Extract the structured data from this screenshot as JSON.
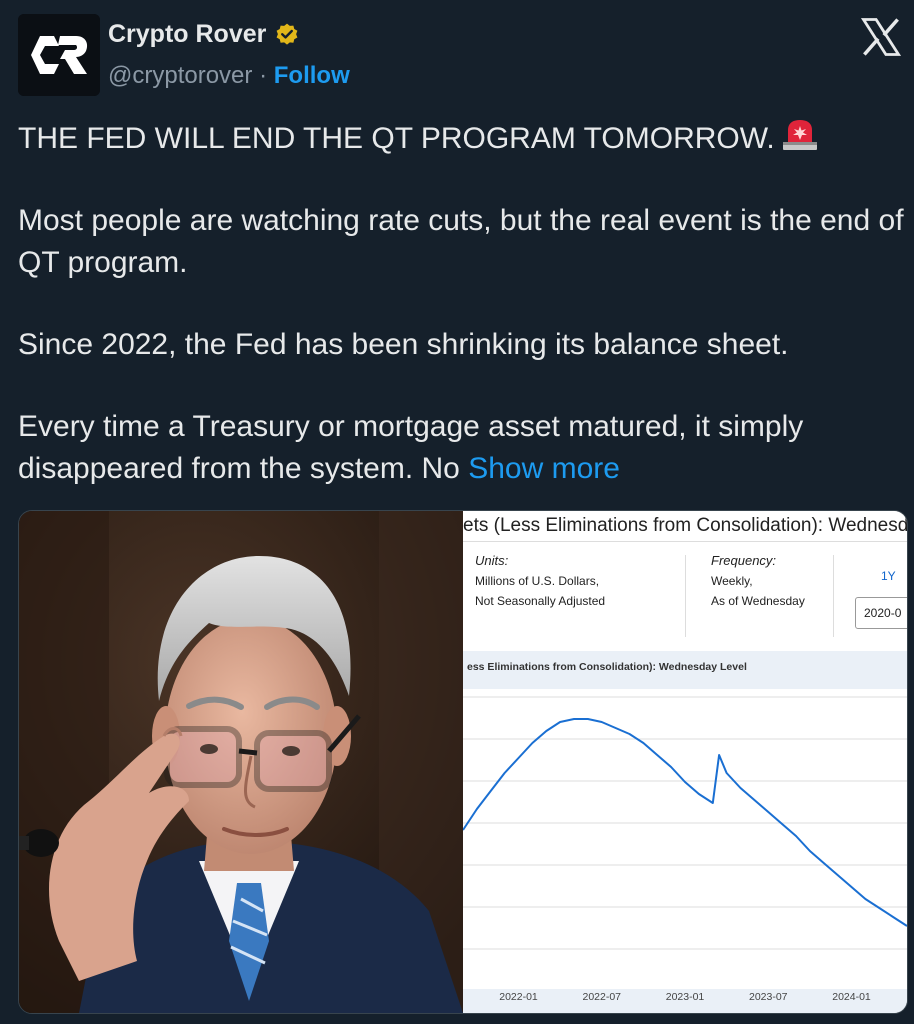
{
  "tweet": {
    "author": {
      "name": "Crypto Rover",
      "handle": "@cryptorover",
      "separator": "·",
      "follow_label": "Follow",
      "avatar_text": "CR"
    },
    "paragraphs": [
      "THE FED WILL END THE QT PROGRAM TOMORROW.",
      "Most people are watching rate cuts, but the real event is the end of QT program.",
      "Since 2022, the Fed has been shrinking its balance sheet.",
      "Every time a Treasury or mortgage asset matured, it simply disappeared from the system. No"
    ],
    "show_more_label": "Show more",
    "icons": {
      "verified": "verified-badge-icon",
      "platform": "x-logo-icon",
      "siren": "siren-emoji-icon"
    },
    "colors": {
      "background": "#15202b",
      "accent": "#1d9bf0",
      "text": "#e7e9ea",
      "muted": "#8b98a5",
      "verified": "#e2b719"
    }
  },
  "media": {
    "fred_panel": {
      "title_fragment": "ets (Less Eliminations from Consolidation): Wednesd",
      "units_label": "Units:",
      "units_line1": "Millions of U.S. Dollars,",
      "units_line2": "Not Seasonally Adjusted",
      "frequency_label": "Frequency:",
      "frequency_line1": "Weekly,",
      "frequency_line2": "As of Wednesday",
      "range_button": "1Y",
      "date_input": "2020-0",
      "chart_title": "ess Eliminations from Consolidation): Wednesday Level"
    }
  },
  "chart_data": {
    "type": "line",
    "title": "ess Eliminations from Consolidation): Wednesday Level",
    "xlabel": "",
    "ylabel": "",
    "x_tick_labels": [
      "2022-01",
      "2022-07",
      "2023-01",
      "2023-07",
      "2024-01"
    ],
    "x_range": [
      "2021-09",
      "2024-05"
    ],
    "y_range": [
      0,
      100
    ],
    "grid": true,
    "series": [
      {
        "color": "#1a6fd2",
        "points": [
          [
            "2021-09",
            53
          ],
          [
            "2021-10",
            60
          ],
          [
            "2021-11",
            66
          ],
          [
            "2021-12",
            72
          ],
          [
            "2022-01",
            77
          ],
          [
            "2022-02",
            82
          ],
          [
            "2022-03",
            86
          ],
          [
            "2022-04",
            89
          ],
          [
            "2022-05",
            90
          ],
          [
            "2022-06",
            90
          ],
          [
            "2022-07",
            89
          ],
          [
            "2022-08",
            87
          ],
          [
            "2022-09",
            85
          ],
          [
            "2022-10",
            82
          ],
          [
            "2022-11",
            78
          ],
          [
            "2022-12",
            74
          ],
          [
            "2023-01",
            69
          ],
          [
            "2023-02",
            65
          ],
          [
            "2023-03",
            62
          ],
          [
            "2023-03-15",
            78
          ],
          [
            "2023-04",
            72
          ],
          [
            "2023-05",
            67
          ],
          [
            "2023-06",
            63
          ],
          [
            "2023-07",
            59
          ],
          [
            "2023-08",
            55
          ],
          [
            "2023-09",
            51
          ],
          [
            "2023-10",
            46
          ],
          [
            "2023-11",
            42
          ],
          [
            "2023-12",
            38
          ],
          [
            "2024-01",
            34
          ],
          [
            "2024-02",
            30
          ],
          [
            "2024-03",
            27
          ],
          [
            "2024-04",
            24
          ],
          [
            "2024-05",
            21
          ]
        ]
      }
    ]
  }
}
